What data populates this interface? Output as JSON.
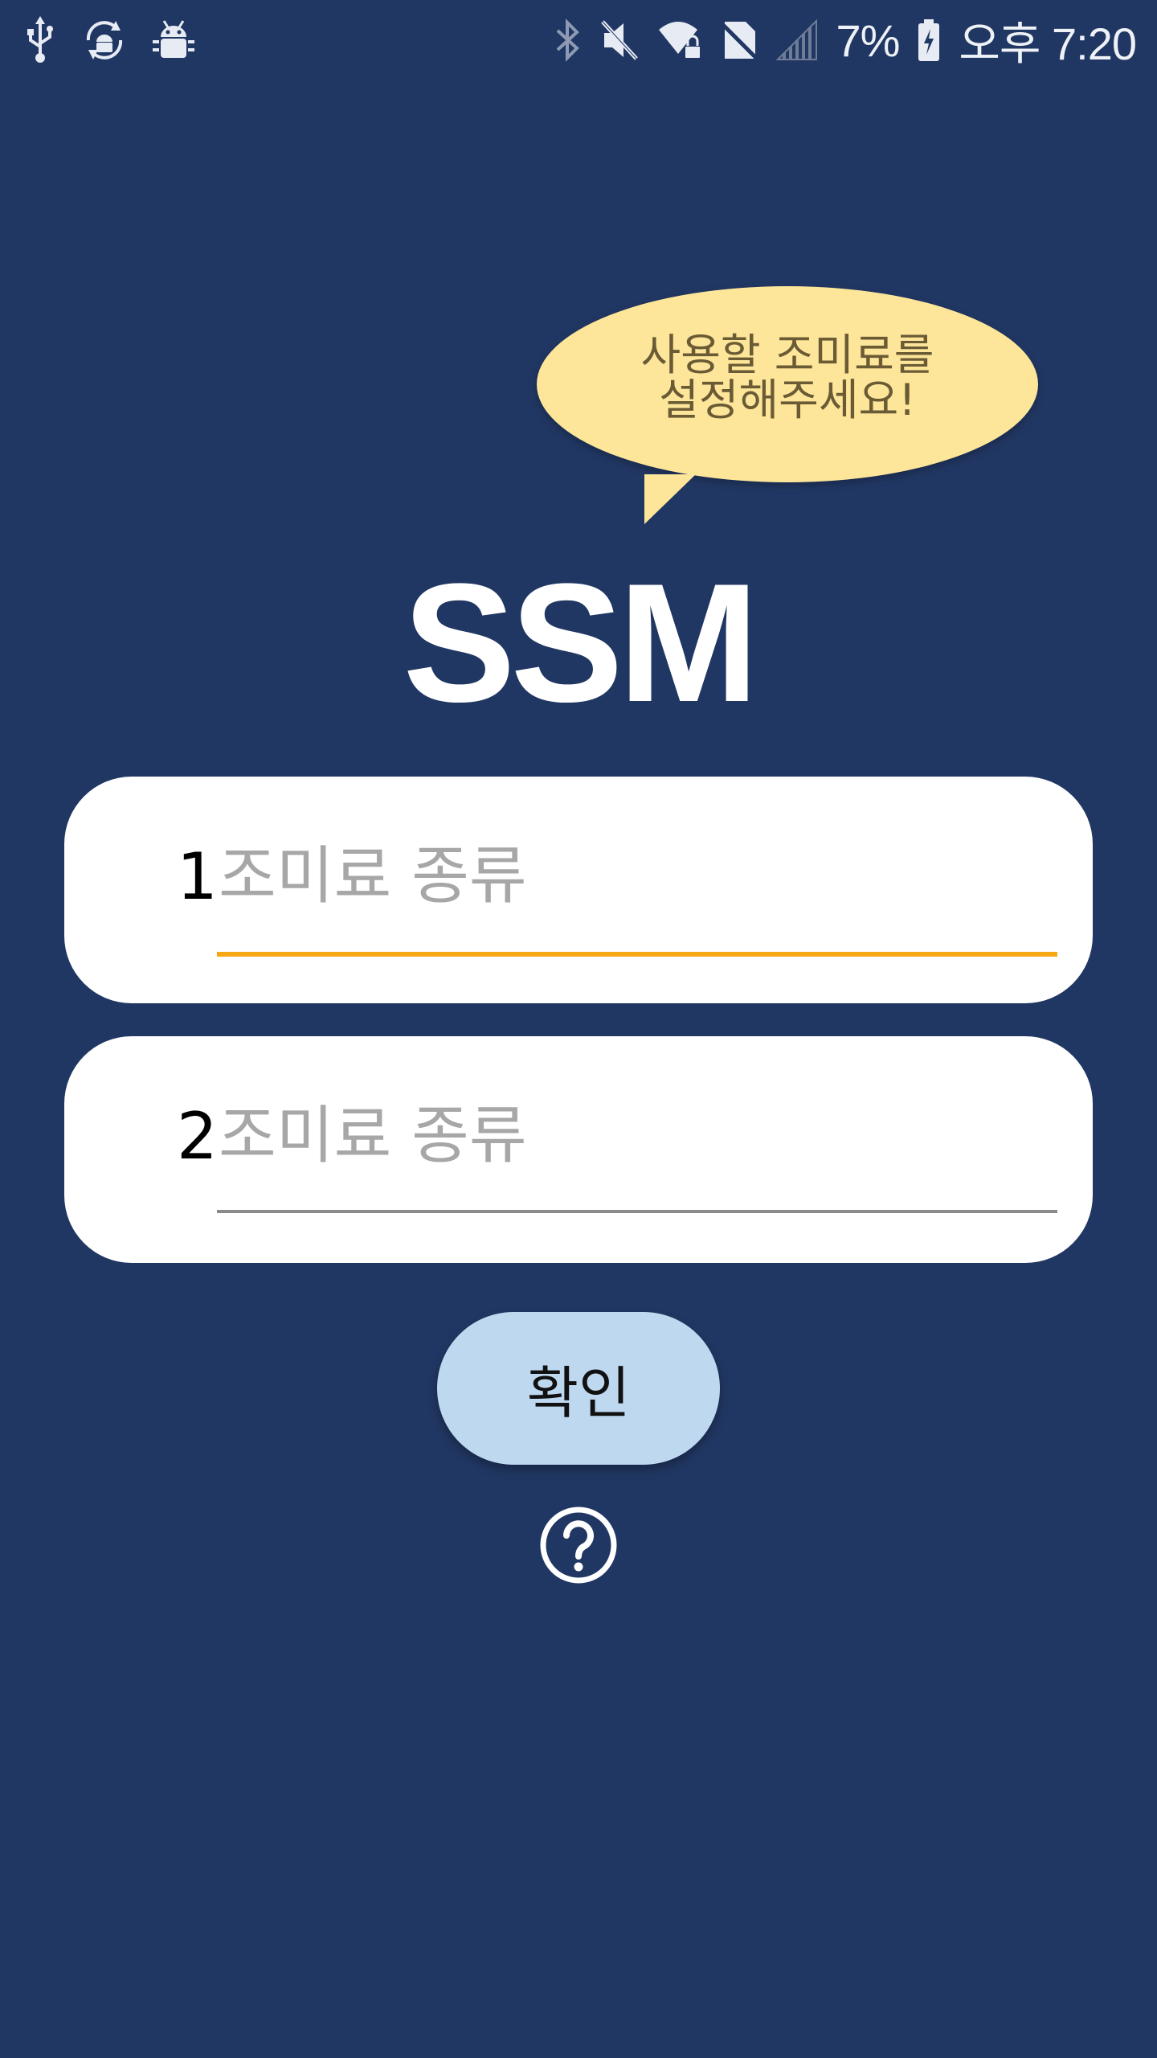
{
  "status_bar": {
    "battery_percent": "7%",
    "time": "오후 7:20",
    "left_icons": [
      "usb-icon",
      "android-sync-icon",
      "android-debug-icon"
    ],
    "right_icons": [
      "bluetooth-icon",
      "mute-icon",
      "wifi-lock-icon",
      "no-sim-icon",
      "signal-icon",
      "battery-icon"
    ]
  },
  "bubble": {
    "line1": "사용할 조미료를",
    "line2": "설정해주세요!"
  },
  "logo": {
    "text": "SSM"
  },
  "inputs": [
    {
      "number": "1",
      "placeholder": "조미료 종류",
      "value": ""
    },
    {
      "number": "2",
      "placeholder": "조미료 종류",
      "value": ""
    }
  ],
  "confirm_button": {
    "label": "확인"
  },
  "colors": {
    "background": "#213763",
    "bubble": "#fde69a",
    "focused_underline": "#f5a716",
    "button": "#bed8f0"
  }
}
